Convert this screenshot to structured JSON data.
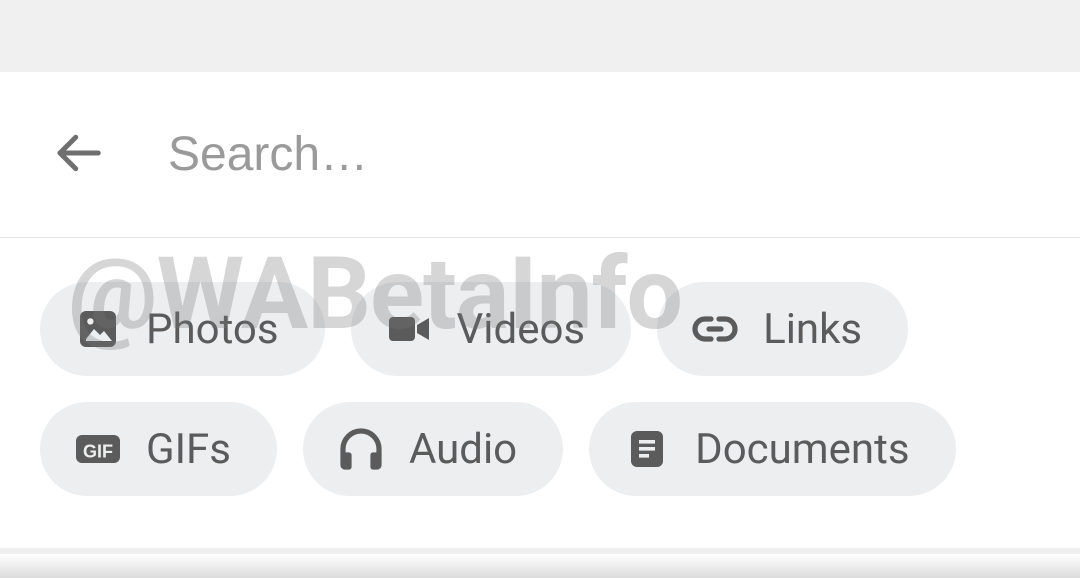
{
  "search": {
    "placeholder": "Search…",
    "value": ""
  },
  "filters": {
    "row1": [
      {
        "key": "photos",
        "label": "Photos",
        "icon": "photo-icon"
      },
      {
        "key": "videos",
        "label": "Videos",
        "icon": "video-icon"
      },
      {
        "key": "links",
        "label": "Links",
        "icon": "link-icon"
      }
    ],
    "row2": [
      {
        "key": "gifs",
        "label": "GIFs",
        "icon": "gif-icon"
      },
      {
        "key": "audio",
        "label": "Audio",
        "icon": "headphones-icon"
      },
      {
        "key": "documents",
        "label": "Documents",
        "icon": "document-icon"
      }
    ]
  },
  "watermark": "@WABetaInfo"
}
